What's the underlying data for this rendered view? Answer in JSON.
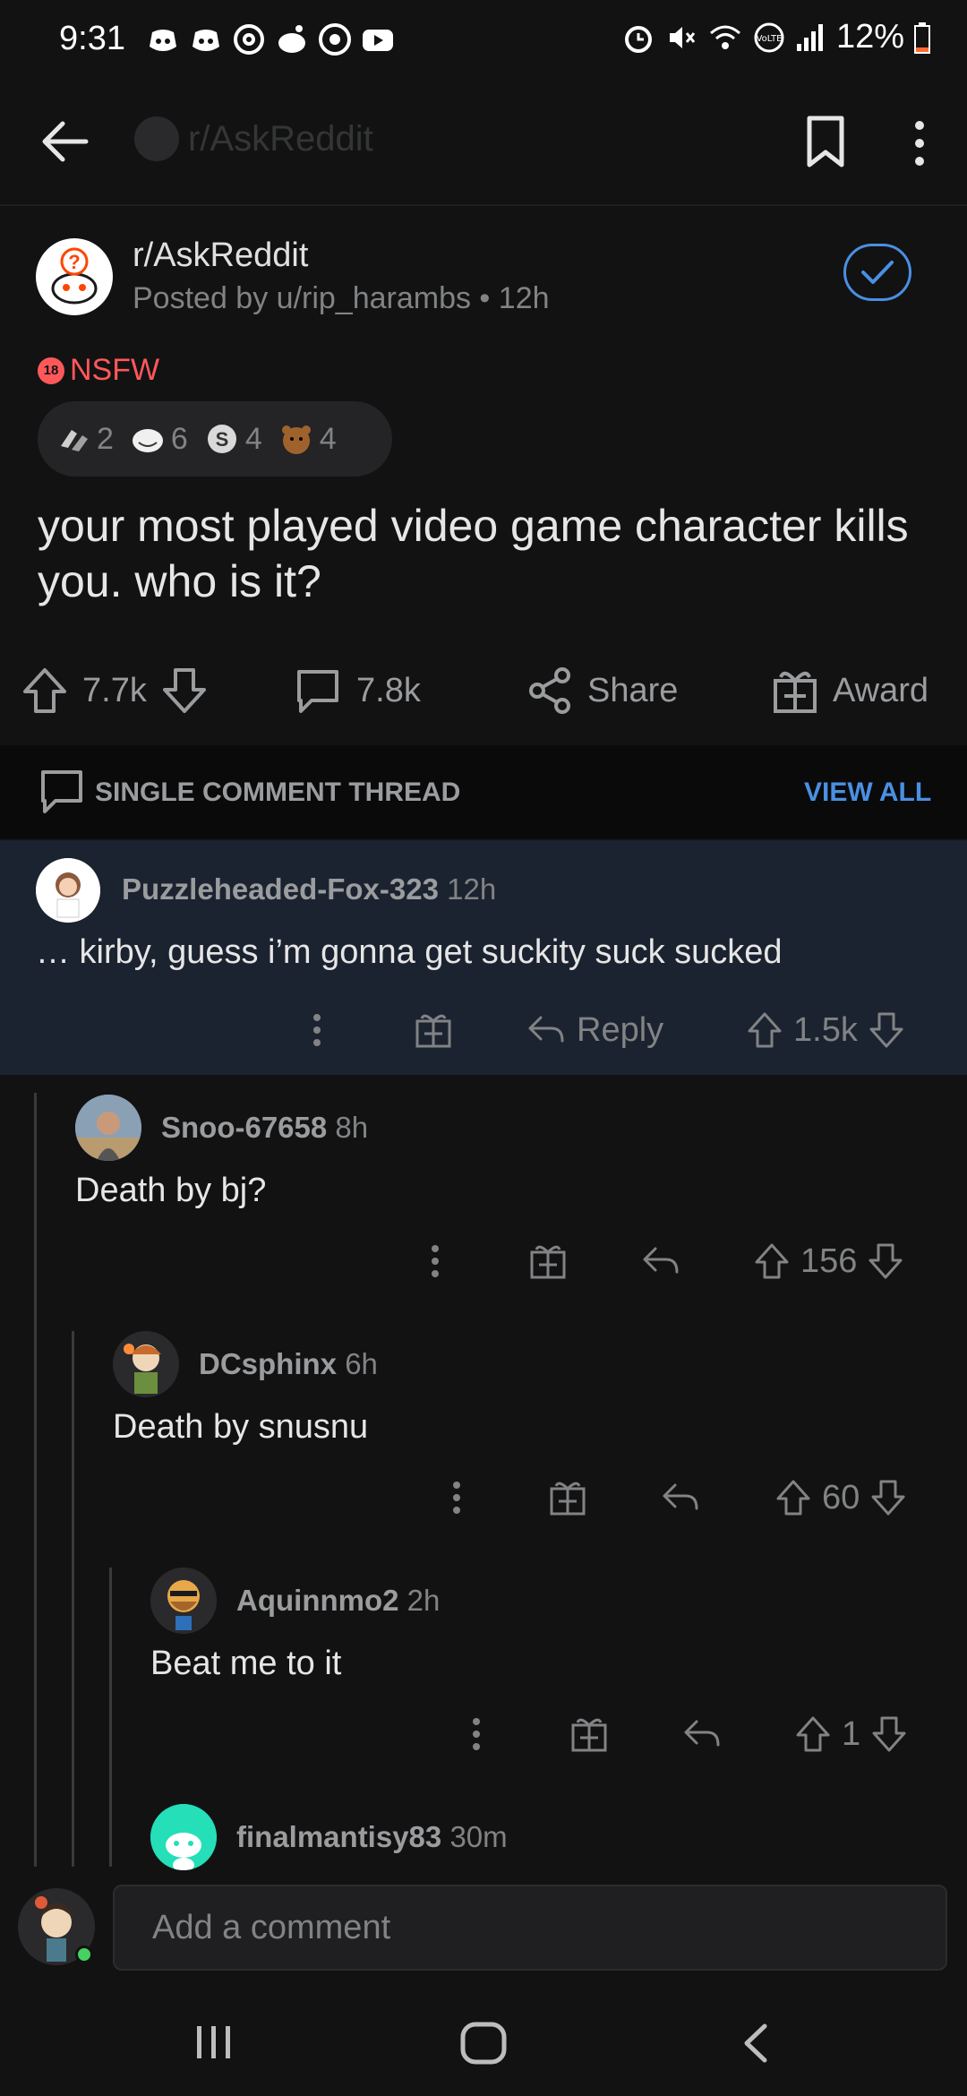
{
  "status_bar": {
    "time": "9:31",
    "battery": "12%",
    "icons_left": [
      "discord-icon",
      "discord-icon",
      "threads-icon",
      "reddit-icon",
      "chrome-icon",
      "youtube-icon"
    ],
    "icons_right": [
      "alarm-icon",
      "mute-icon",
      "wifi-icon",
      "volte-icon",
      "signal-icon",
      "battery-icon"
    ]
  },
  "app_bar": {
    "title": "r/AskReddit"
  },
  "post": {
    "subreddit": "r/AskReddit",
    "meta": "Posted by u/rip_harambs • 12h",
    "nsfw_label": "NSFW",
    "nsfw_badge": "18",
    "awards": [
      {
        "icon": "award-hands-icon",
        "count": "2"
      },
      {
        "icon": "award-face-icon",
        "count": "6"
      },
      {
        "icon": "award-s-icon",
        "count": "4"
      },
      {
        "icon": "award-bear-icon",
        "count": "4"
      }
    ],
    "title": "your most played video game character kills you. who is it?",
    "votes": "7.7k",
    "comments": "7.8k",
    "share_label": "Share",
    "award_label": "Award"
  },
  "thread_bar": {
    "label": "SINGLE COMMENT THREAD",
    "view_all": "VIEW ALL"
  },
  "comments": [
    {
      "user": "Puzzleheaded-Fox-323",
      "time": "12h",
      "body": "… kirby, guess i’m gonna get suckity suck sucked",
      "reply_label": "Reply",
      "votes": "1.5k"
    },
    {
      "user": "Snoo-67658",
      "time": "8h",
      "body": "Death by bj?",
      "votes": "156"
    },
    {
      "user": "DCsphinx",
      "time": "6h",
      "body": "Death by snusnu",
      "votes": "60"
    },
    {
      "user": "Aquinnmo2",
      "time": "2h",
      "body": "Beat me to it",
      "votes": "1"
    },
    {
      "user": "finalmantisy83",
      "time": "30m"
    }
  ],
  "composer": {
    "placeholder": "Add a comment"
  },
  "colors": {
    "background": "#121213",
    "highlight": "#1c2330",
    "accent": "#4a90e2",
    "nsfw": "#ff585b"
  }
}
